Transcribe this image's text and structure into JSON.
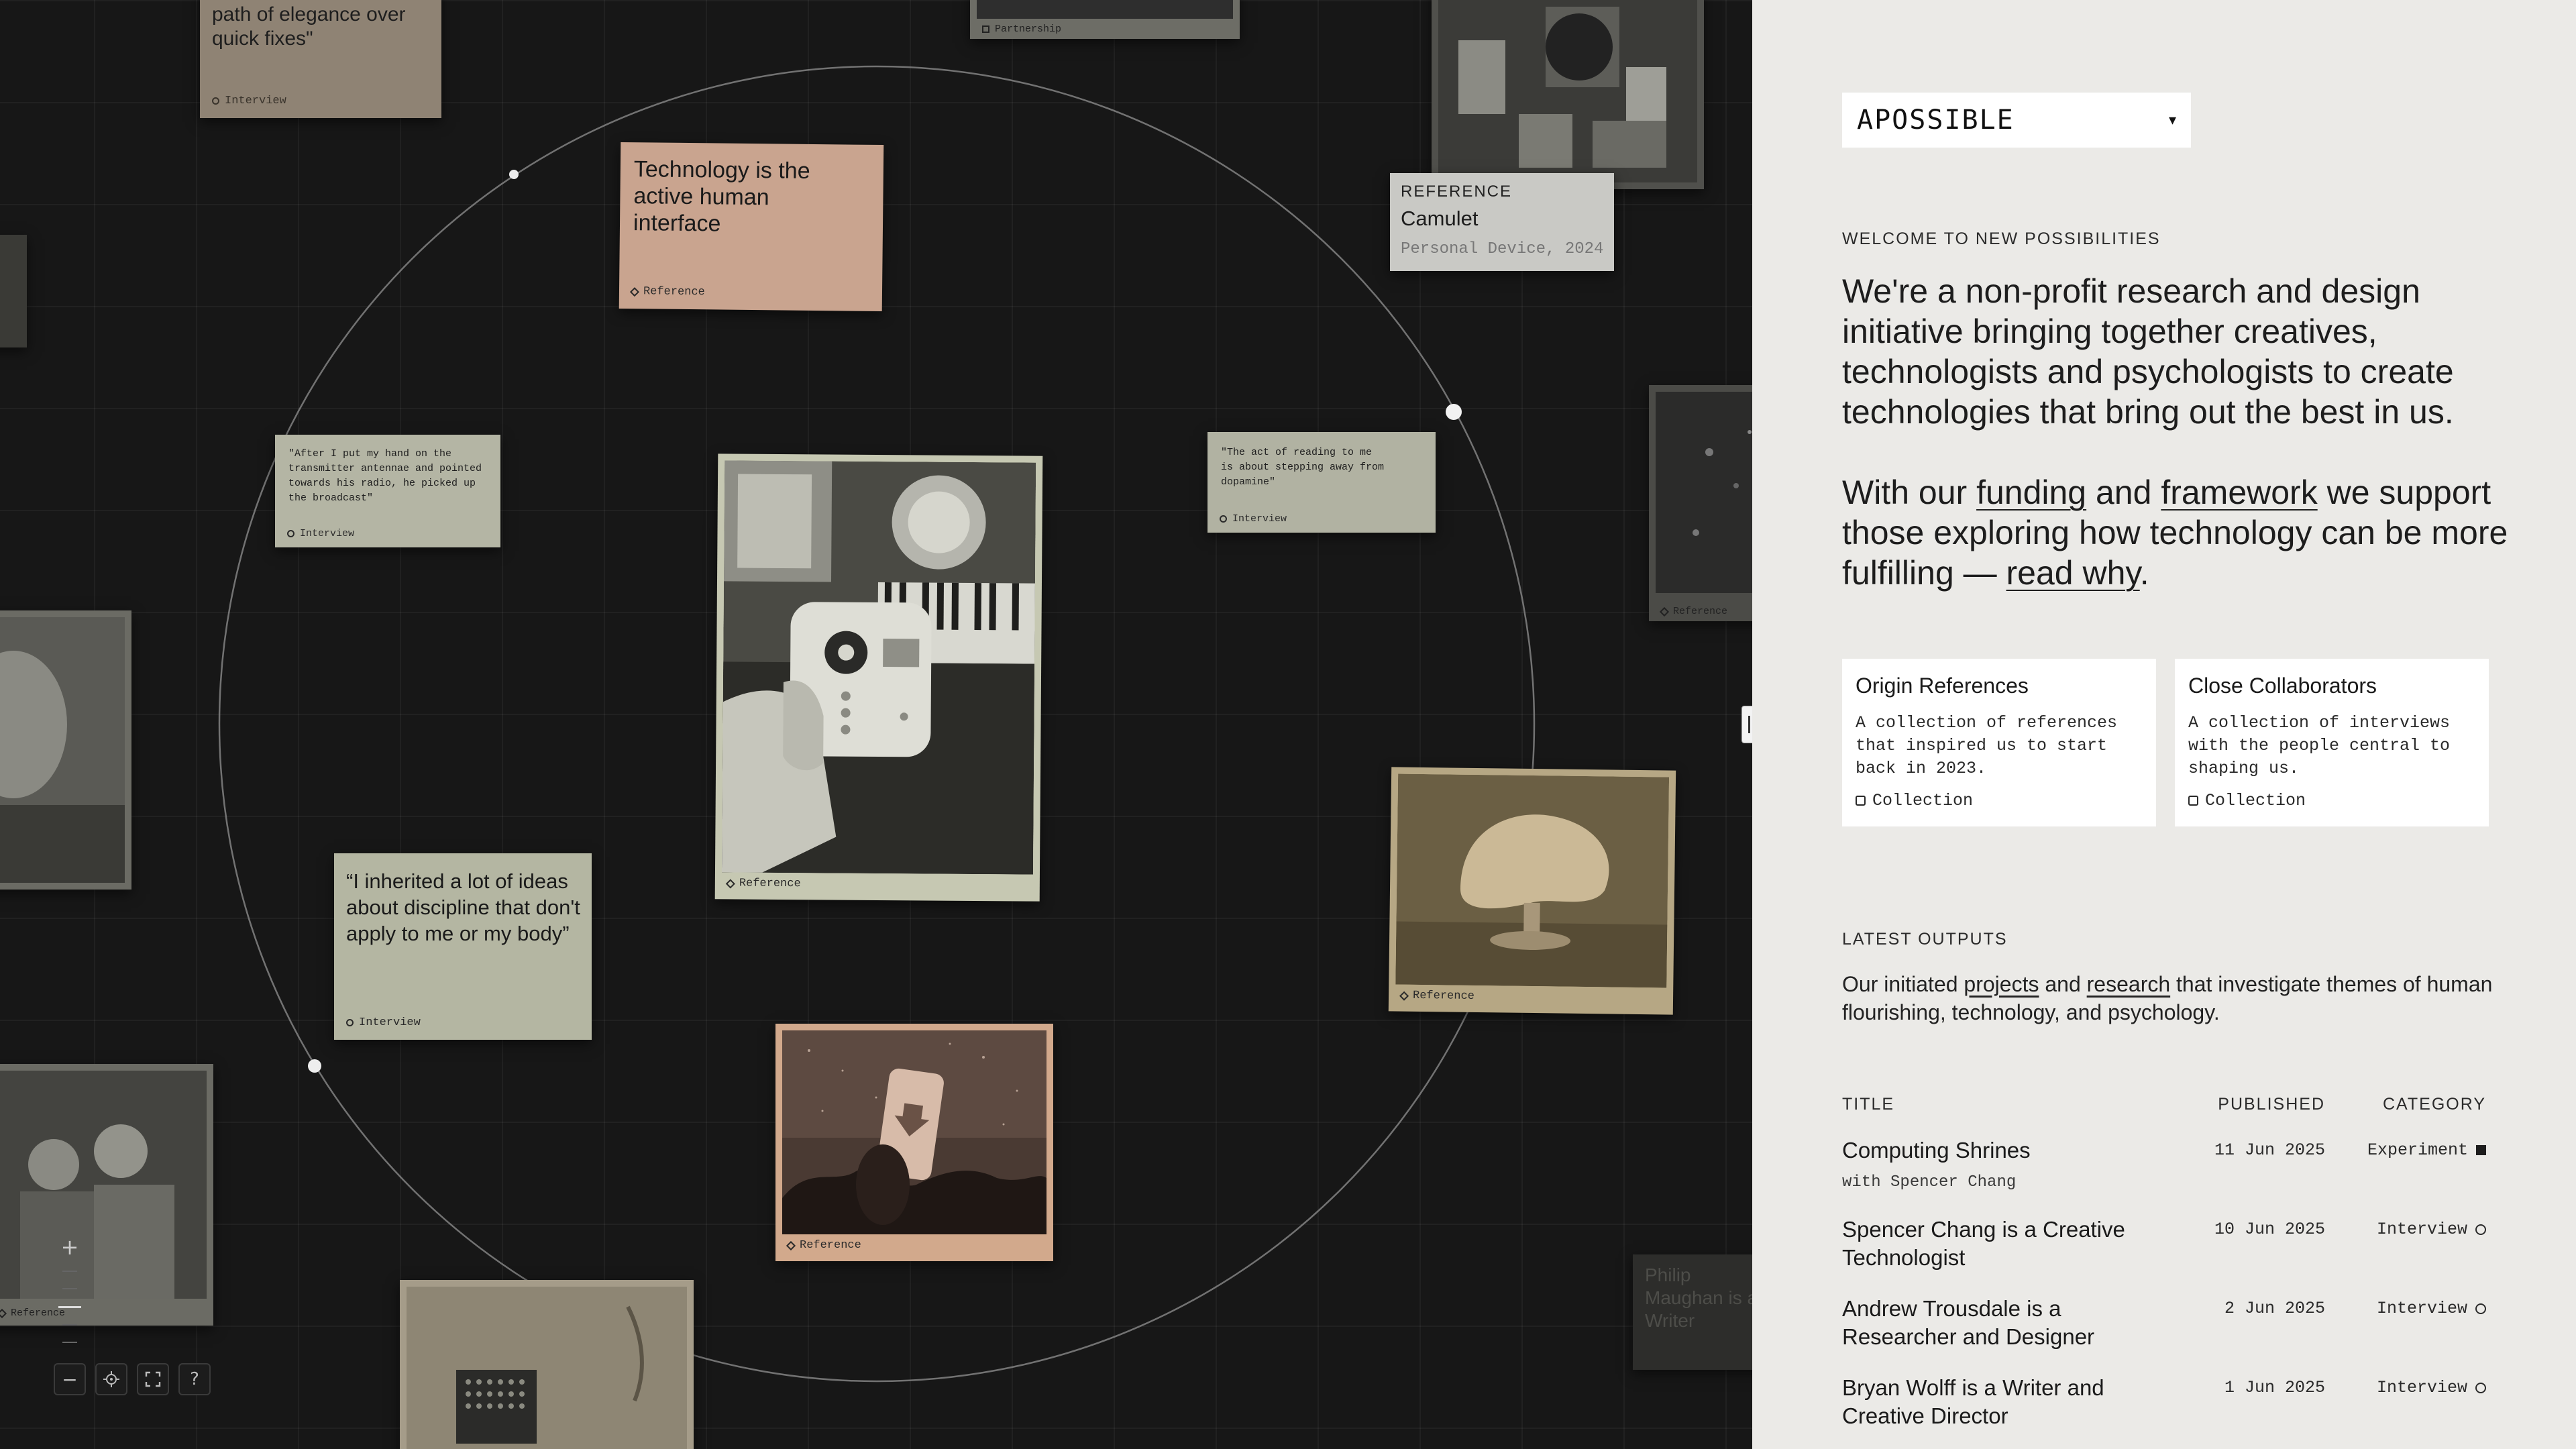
{
  "canvas": {
    "cards": {
      "elegance": {
        "text": "path of elegance over quick fixes\"",
        "tag": "Interview"
      },
      "partnership": {
        "tag": "Partnership"
      },
      "tech_human": {
        "text": "Technology is the active human interface",
        "tag": "Reference"
      },
      "camulet": {
        "kicker": "REFERENCE",
        "title": "Camulet",
        "meta": "Personal Device, 2024"
      },
      "antennae": {
        "text": "\"After I put my hand on the transmitter antennae and pointed towards his radio, he picked up the broadcast\"",
        "tag": "Interview"
      },
      "reading": {
        "text": "\"The act of reading to me is about stepping away from dopamine\"",
        "tag": "Interview"
      },
      "device_photo": {
        "tag": "Reference"
      },
      "lamp_photo": {
        "tag": "Reference"
      },
      "discipline": {
        "text": "“I inherited a lot of ideas about discipline that don't apply to me or my body”",
        "tag": "Interview"
      },
      "phone_photo": {
        "tag": "Reference"
      },
      "right_edge_photo": {
        "tag": "Reference"
      },
      "philip": {
        "text": "Philip Maughan is a Writer"
      },
      "left_group_photo": {
        "tag": "Reference"
      }
    },
    "controls": {
      "zoom_in": "+",
      "zoom_out": "−",
      "help": "?"
    }
  },
  "panel": {
    "brand": {
      "logo": "APOSSIBLE",
      "caret": "▾"
    },
    "welcome_eyebrow": "WELCOME TO NEW POSSIBILITIES",
    "intro_p1": "We're a non-profit research and design initiative bringing together creatives, technologists and psychologists to create technologies that bring out the best in us.",
    "intro_p2": {
      "a": "With our ",
      "funding": "funding",
      "b": " and ",
      "framework": "framework",
      "c": " we support those exploring how technology can be more fulfilling — ",
      "read_why": "read why",
      "d": "."
    },
    "collections": [
      {
        "title": "Origin References",
        "desc": "A collection of references that inspired us to start back in 2023.",
        "type": "Collection"
      },
      {
        "title": "Close Collaborators",
        "desc": "A collection of interviews with the people central to shaping us.",
        "type": "Collection"
      }
    ],
    "outputs_eyebrow": "LATEST OUTPUTS",
    "outputs_desc": {
      "a": "Our initiated ",
      "projects": "projects",
      "b": " and ",
      "research": "research",
      "c": " that investigate themes of human flourishing, technology, and psychology."
    },
    "table": {
      "headers": {
        "title": "TITLE",
        "published": "PUBLISHED",
        "category": "CATEGORY"
      },
      "rows": [
        {
          "title": "Computing Shrines",
          "sub": "with Spencer Chang",
          "date": "11 Jun 2025",
          "category": "Experiment",
          "marker": "square"
        },
        {
          "title": "Spencer Chang is a Creative Technologist",
          "sub": "",
          "date": "10 Jun 2025",
          "category": "Interview",
          "marker": "circle"
        },
        {
          "title": "Andrew Trousdale is a Researcher and Designer",
          "sub": "",
          "date": "2 Jun 2025",
          "category": "Interview",
          "marker": "circle"
        },
        {
          "title": "Bryan Wolff is a Writer and Creative Director",
          "sub": "",
          "date": "1 Jun 2025",
          "category": "Interview",
          "marker": "circle"
        }
      ]
    }
  }
}
